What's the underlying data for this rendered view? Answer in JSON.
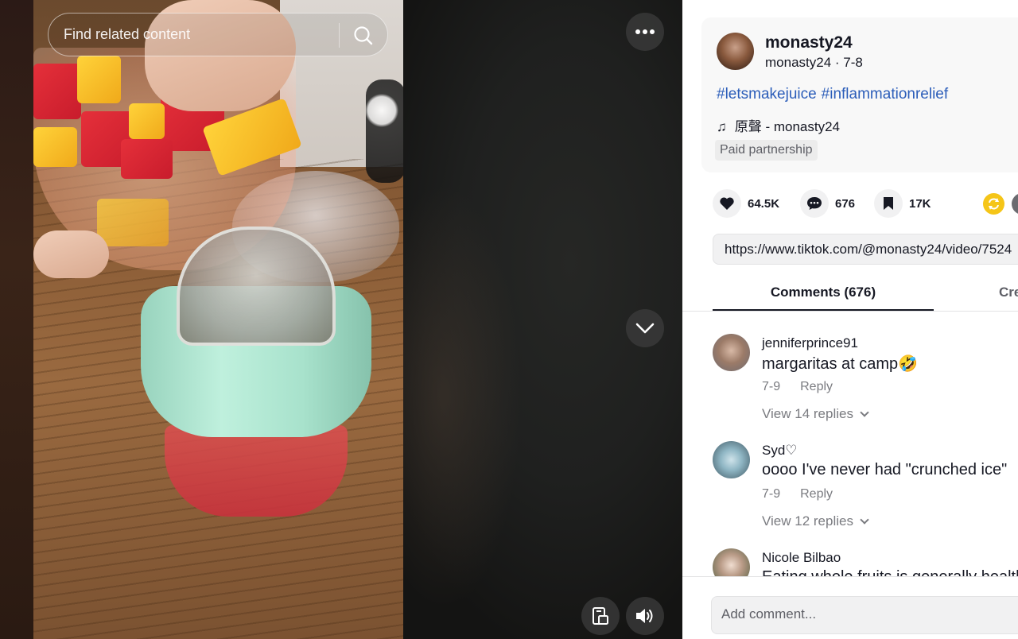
{
  "search": {
    "placeholder": "Find related content"
  },
  "author": {
    "name": "monasty24",
    "subline": "monasty24 · 7-8"
  },
  "caption": {
    "hashtags": [
      "#letsmakejuice",
      "#inflammationrelief"
    ],
    "music": "原聲 - monasty24",
    "paid_label": "Paid partnership"
  },
  "stats": {
    "likes": "64.5K",
    "comments": "676",
    "saves": "17K"
  },
  "link": {
    "url": "https://www.tiktok.com/@monasty24/video/7524"
  },
  "tabs": {
    "comments": "Comments (676)",
    "creator": "Cre"
  },
  "comments": [
    {
      "user": "jenniferprince91",
      "text": "margaritas at camp🤣",
      "date": "7-9",
      "reply": "Reply",
      "view_replies": "View 14 replies"
    },
    {
      "user": "Syd♡",
      "text": "oooo I've never had \"crunched ice\"",
      "date": "7-9",
      "reply": "Reply",
      "view_replies": "View 12 replies"
    },
    {
      "user": "Nicole Bilbao",
      "text": "Eating whole fruits is generally health"
    }
  ],
  "add_comment": {
    "placeholder": "Add comment..."
  },
  "colors": {
    "hashtag": "#2b5db9",
    "share_accent": "#f5c518",
    "text_primary": "#161823",
    "text_secondary": "#7a7b80"
  }
}
